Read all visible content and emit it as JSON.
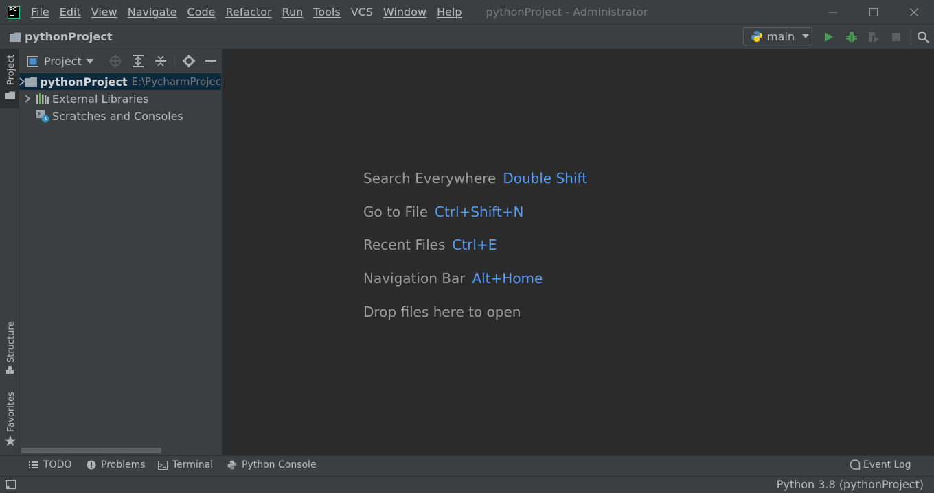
{
  "titlebar": {
    "menu": [
      "File",
      "Edit",
      "View",
      "Navigate",
      "Code",
      "Refactor",
      "Run",
      "Tools",
      "VCS",
      "Window",
      "Help"
    ],
    "window_title": "pythonProject - Administrator"
  },
  "navbar": {
    "breadcrumb": "pythonProject",
    "run_config": "main"
  },
  "left_strip": {
    "tabs": [
      "Project",
      "Structure",
      "Favorites"
    ]
  },
  "project_panel": {
    "title": "Project",
    "tree": [
      {
        "label": "pythonProject",
        "path": "E:\\PycharmProjec",
        "selected": true
      },
      {
        "label": "External Libraries"
      },
      {
        "label": "Scratches and Consoles"
      }
    ]
  },
  "editor": {
    "hints": [
      {
        "label": "Search Everywhere",
        "key": "Double Shift"
      },
      {
        "label": "Go to File",
        "key": "Ctrl+Shift+N"
      },
      {
        "label": "Recent Files",
        "key": "Ctrl+E"
      },
      {
        "label": "Navigation Bar",
        "key": "Alt+Home"
      },
      {
        "label": "Drop files here to open",
        "key": ""
      }
    ]
  },
  "bottom_tools": {
    "todo": "TODO",
    "problems": "Problems",
    "terminal": "Terminal",
    "python_console": "Python Console",
    "event_log": "Event Log"
  },
  "statusbar": {
    "interpreter": "Python 3.8 (pythonProject)"
  },
  "colors": {
    "chrome_bg": "#3c3f41",
    "editor_bg": "#2b2b2b",
    "key_accent": "#589df6",
    "run_green": "#499c54",
    "selection": "#0d293e"
  }
}
